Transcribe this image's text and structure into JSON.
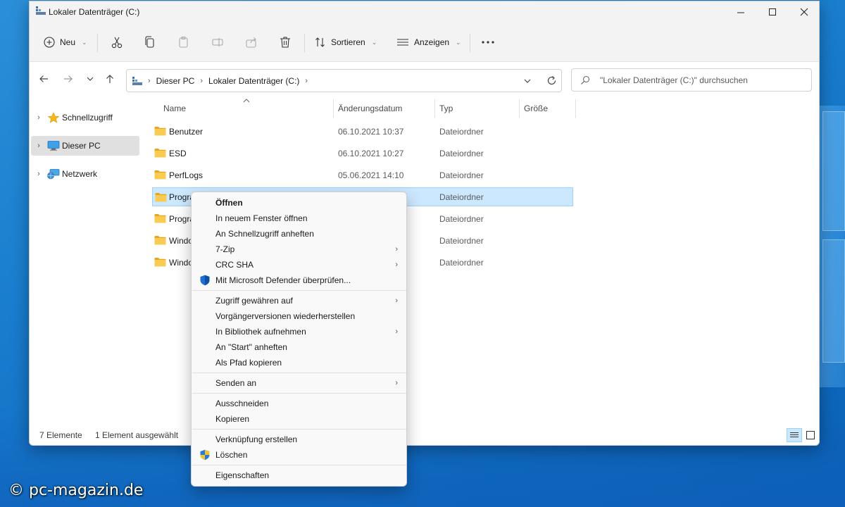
{
  "window": {
    "title": "Lokaler Datenträger (C:)"
  },
  "toolbar": {
    "new_label": "Neu",
    "sort_label": "Sortieren",
    "view_label": "Anzeigen",
    "icons": [
      "cut-icon",
      "copy-icon",
      "paste-icon",
      "rename-icon",
      "share-icon",
      "delete-icon",
      "more-icon"
    ]
  },
  "address": {
    "segments": [
      "Dieser PC",
      "Lokaler Datenträger (C:)"
    ]
  },
  "search": {
    "placeholder": "\"Lokaler Datenträger (C:)\" durchsuchen"
  },
  "sidebar": {
    "items": [
      {
        "label": "Schnellzugriff",
        "icon": "star-icon"
      },
      {
        "label": "Dieser PC",
        "icon": "computer-icon",
        "selected": true
      },
      {
        "label": "Netzwerk",
        "icon": "network-icon"
      }
    ]
  },
  "columns": {
    "name": "Name",
    "date": "Änderungsdatum",
    "type": "Typ",
    "size": "Größe"
  },
  "rows": [
    {
      "name": "Benutzer",
      "date": "06.10.2021 10:37",
      "type": "Dateiordner"
    },
    {
      "name": "ESD",
      "date": "06.10.2021 10:27",
      "type": "Dateiordner"
    },
    {
      "name": "PerfLogs",
      "date": "05.06.2021 14:10",
      "type": "Dateiordner"
    },
    {
      "name": "Progra",
      "date": "",
      "type": "Dateiordner",
      "selected": true
    },
    {
      "name": "Progra",
      "date": "",
      "type": "Dateiordner"
    },
    {
      "name": "Windo",
      "date": "",
      "type": "Dateiordner"
    },
    {
      "name": "Windo",
      "date": "",
      "type": "Dateiordner"
    }
  ],
  "status": {
    "count": "7 Elemente",
    "selection": "1 Element ausgewählt"
  },
  "context_menu": {
    "groups": [
      [
        {
          "label": "Öffnen",
          "bold": true
        },
        {
          "label": "In neuem Fenster öffnen"
        },
        {
          "label": "An Schnellzugriff anheften"
        },
        {
          "label": "7-Zip",
          "submenu": true
        },
        {
          "label": "CRC SHA",
          "submenu": true
        },
        {
          "label": "Mit Microsoft Defender überprüfen...",
          "icon": "defender-shield-icon"
        }
      ],
      [
        {
          "label": "Zugriff gewähren auf",
          "submenu": true
        },
        {
          "label": "Vorgängerversionen wiederherstellen"
        },
        {
          "label": "In Bibliothek aufnehmen",
          "submenu": true
        },
        {
          "label": "An \"Start\" anheften"
        },
        {
          "label": "Als Pfad kopieren"
        }
      ],
      [
        {
          "label": "Senden an",
          "submenu": true
        }
      ],
      [
        {
          "label": "Ausschneiden"
        },
        {
          "label": "Kopieren"
        }
      ],
      [
        {
          "label": "Verknüpfung erstellen"
        },
        {
          "label": "Löschen",
          "icon": "uac-shield-icon"
        }
      ],
      [
        {
          "label": "Eigenschaften"
        }
      ]
    ]
  },
  "watermark": "© pc-magazin.de",
  "colors": {
    "selection": "#cce8ff",
    "selection_border": "#99d1ff",
    "folder": "#f5c34a",
    "desktop": "#1a7dd0"
  }
}
